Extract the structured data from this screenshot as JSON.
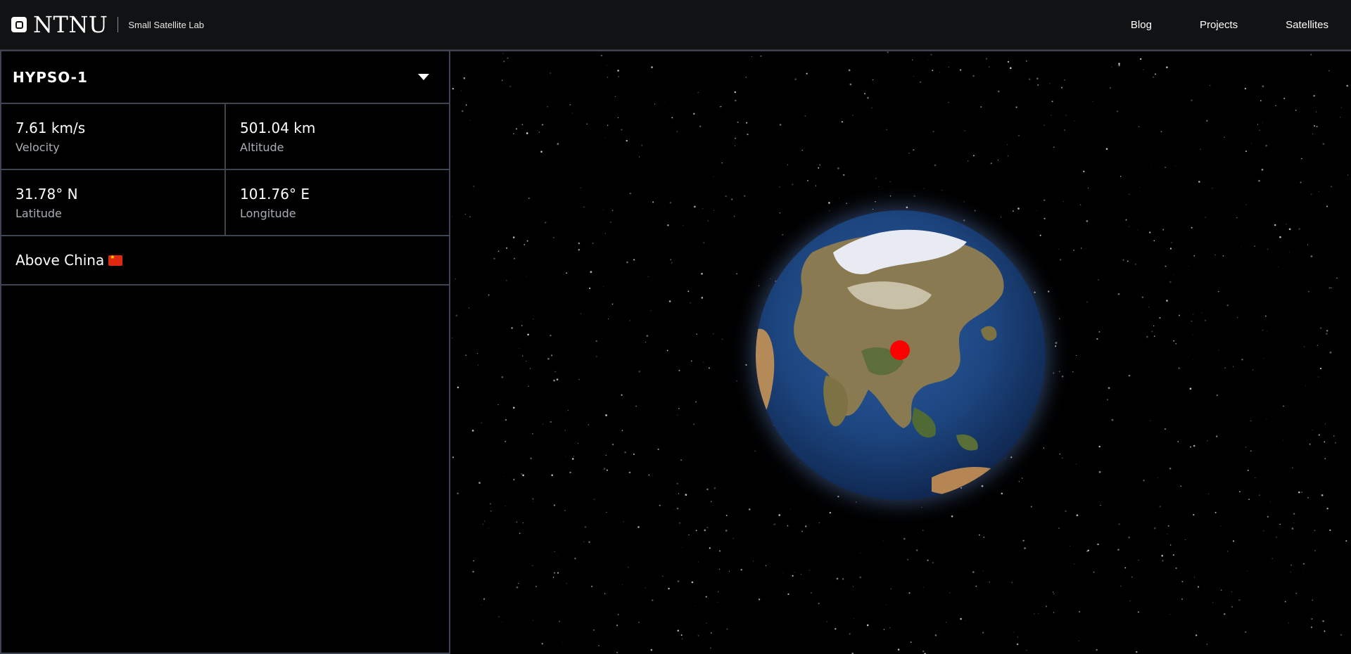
{
  "header": {
    "brand": "NTNU",
    "subtitle": "Small Satellite Lab",
    "nav": [
      "Blog",
      "Projects",
      "Satellites"
    ]
  },
  "satellite": {
    "name": "HYPSO-1",
    "stats": [
      {
        "value": "7.61 km/s",
        "label": "Velocity"
      },
      {
        "value": "501.04 km",
        "label": "Altitude"
      },
      {
        "value": "31.78° N",
        "label": "Latitude"
      },
      {
        "value": "101.76° E",
        "label": "Longitude"
      }
    ],
    "location": "Above China"
  },
  "colors": {
    "marker": "#ff0000",
    "border": "#3f4550",
    "header_bg": "#111213"
  },
  "icons": [
    "logo-icon",
    "chevron-down-icon",
    "china-flag-icon",
    "satellite-marker-icon"
  ]
}
